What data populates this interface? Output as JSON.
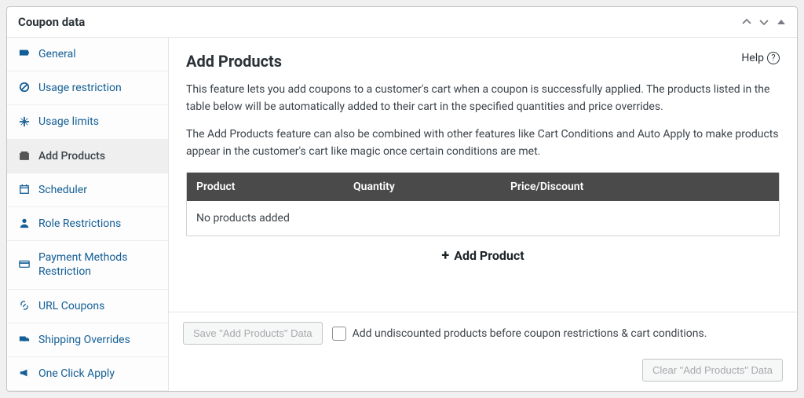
{
  "panel": {
    "title": "Coupon data"
  },
  "sidebar": {
    "items": [
      {
        "label": "General"
      },
      {
        "label": "Usage restriction"
      },
      {
        "label": "Usage limits"
      },
      {
        "label": "Add Products"
      },
      {
        "label": "Scheduler"
      },
      {
        "label": "Role Restrictions"
      },
      {
        "label": "Payment Methods Restriction"
      },
      {
        "label": "URL Coupons"
      },
      {
        "label": "Shipping Overrides"
      },
      {
        "label": "One Click Apply"
      }
    ]
  },
  "main": {
    "title": "Add Products",
    "help_label": "Help",
    "desc1": "This feature lets you add coupons to a customer's cart when a coupon is successfully applied. The products listed in the table below will be automatically added to their cart in the specified quantities and price overrides.",
    "desc2": "The Add Products feature can also be combined with other features like Cart Conditions and Auto Apply to make products appear in the customer's cart like magic once certain conditions are met.",
    "table": {
      "headers": {
        "product": "Product",
        "quantity": "Quantity",
        "price": "Price/Discount"
      },
      "empty_text": "No products added"
    },
    "add_product_label": "Add Product"
  },
  "footer": {
    "save_label": "Save \"Add Products\" Data",
    "checkbox_label": "Add undiscounted products before coupon restrictions & cart conditions.",
    "clear_label": "Clear \"Add Products\" Data"
  }
}
